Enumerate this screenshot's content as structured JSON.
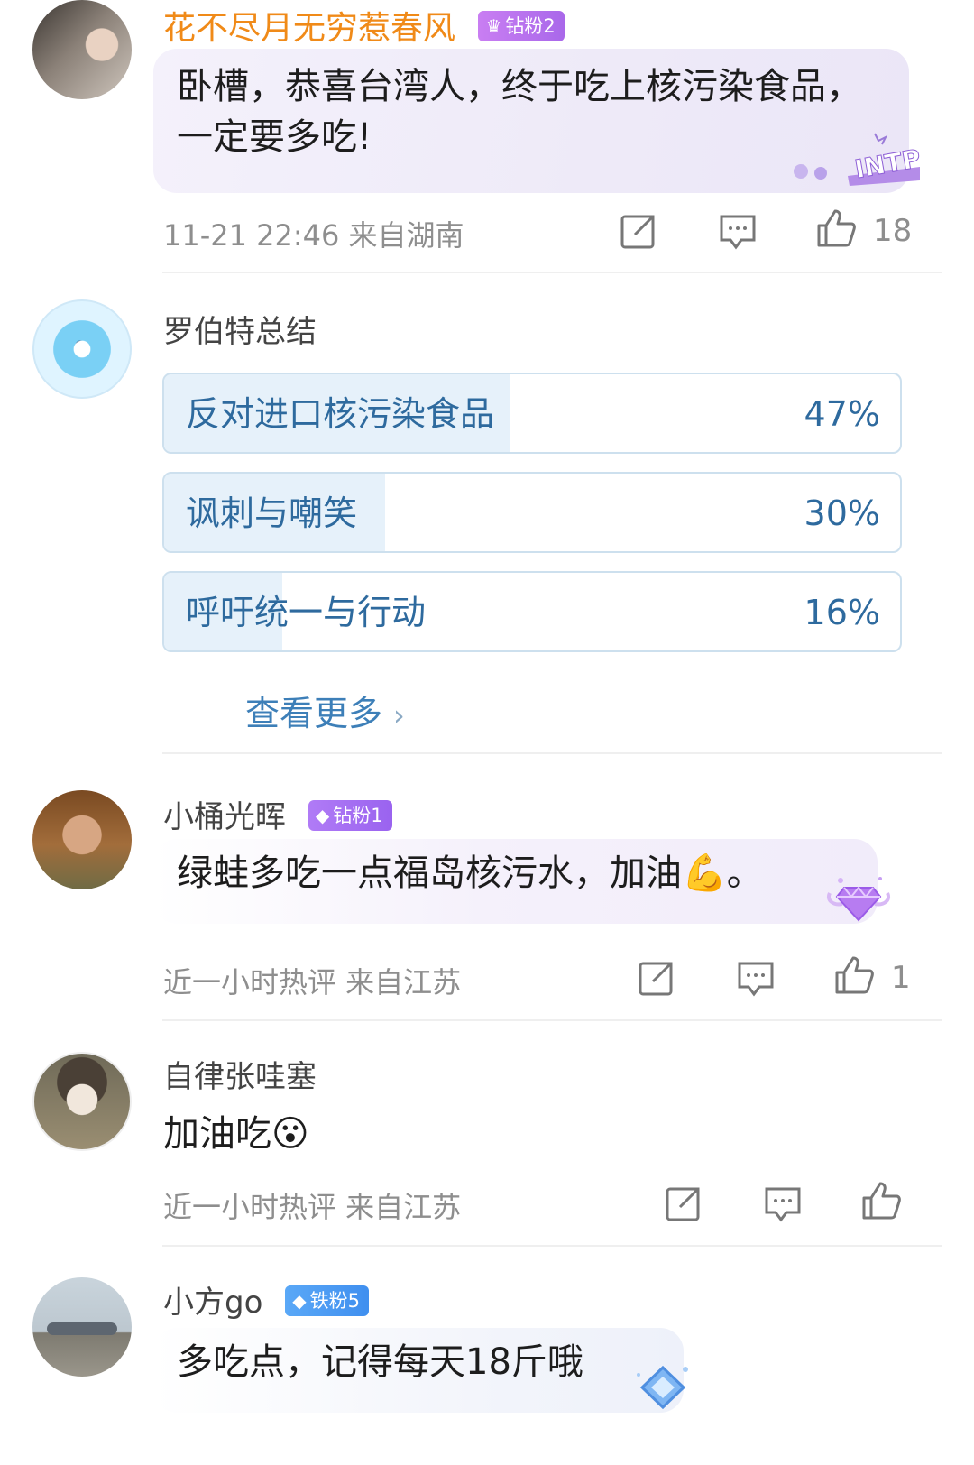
{
  "comments": [
    {
      "username": "花不尽月无穷惹春风",
      "badge": "钻粉2",
      "text": "卧槽，恭喜台湾人，终于吃上核污染食品，一定要多吃!",
      "line1": "卧槽，恭喜台湾人，终于吃上核污染食品，一定要多吃!",
      "meta": "11-21 22:46  来自湖南",
      "likes": "18",
      "sticker": "INTP"
    },
    {
      "username": "小桶光晖",
      "badge": "钻粉1",
      "text": "绿蛙多吃一点福岛核污水，加油💪。",
      "meta": "近一小时热评  来自江苏",
      "likes": "1"
    },
    {
      "username": "自律张哇塞",
      "text": "加油吃😮",
      "meta": "近一小时热评  来自江苏",
      "likes": ""
    },
    {
      "username": "小方go",
      "badge": "铁粉5",
      "text": "多吃点，记得每天18斤哦"
    }
  ],
  "poll": {
    "username": "罗伯特总结",
    "options": [
      {
        "label": "反对进口核污染食品",
        "pct": "47%",
        "value": 0.47
      },
      {
        "label": "讽刺与嘲笑",
        "pct": "30%",
        "value": 0.3
      },
      {
        "label": "呼吁统一与行动",
        "pct": "16%",
        "value": 0.16
      }
    ],
    "see_more": "查看更多"
  },
  "icons": {
    "share": "share-icon",
    "comment": "comment-icon",
    "like": "thumbs-up-icon"
  },
  "colors": {
    "username_highlight": "#f08a18",
    "poll_text": "#2e6a9e",
    "poll_fill": "#e6f1fa",
    "meta_text": "#8e8e8e"
  }
}
